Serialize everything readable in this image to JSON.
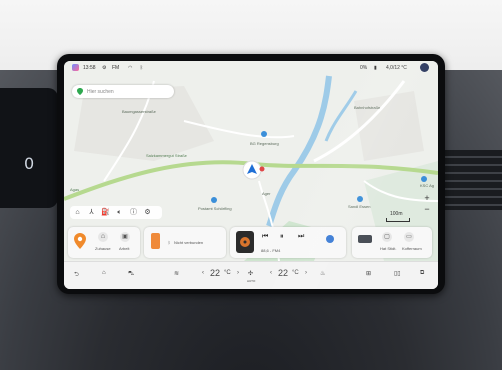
{
  "status_bar": {
    "time": "13:58",
    "fm_label": "FM",
    "battery_percent": "0%",
    "temperature": "4,0/12 °C"
  },
  "search": {
    "placeholder": "Hier suchen"
  },
  "map": {
    "labels": [
      "Baumgasserstraße",
      "Salzkammergut Straße",
      "Bahnhofstraße",
      "Agas",
      "Ager",
      "BG Regensburg",
      "Postamt Schörfling",
      "Sandl Essen",
      "KSC Ag"
    ],
    "scale_label": "100m",
    "zoom_in": "+",
    "zoom_out": "−"
  },
  "cards": {
    "shortcuts": {
      "items": [
        "Zuhause",
        "Arbeit"
      ]
    },
    "phone": {
      "status": "Nicht verbunden"
    },
    "media": {
      "station": "88,6 - FM4",
      "controls": [
        "⏮",
        "⏸",
        "⏭"
      ]
    },
    "vehicle": {
      "items": [
        "Hat Stidt.",
        "Kofferraum"
      ]
    }
  },
  "dock": {
    "temp_left": "22",
    "temp_right": "22",
    "temp_unit": "°C",
    "fan_label": "AUTO"
  },
  "icons": {
    "back": "back-icon",
    "home": "home-icon",
    "car": "car-icon",
    "seat_heat": "seat-heat-icon",
    "fan": "fan-icon",
    "rear_defrost": "rear-defrost-icon",
    "apps": "apps-grid-icon",
    "split": "split-view-icon",
    "windows": "windows-icon"
  }
}
